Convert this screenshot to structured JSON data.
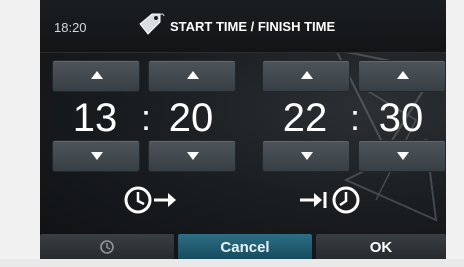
{
  "header": {
    "time": "18:20",
    "title": "START TIME / FINISH TIME",
    "title_icon": "price-tag-icon"
  },
  "start": {
    "hours": "13",
    "minutes": "20",
    "separator": ":",
    "icon": "clock-arrow-out-icon"
  },
  "finish": {
    "hours": "22",
    "minutes": "30",
    "separator": ":",
    "icon": "arrow-in-clock-icon"
  },
  "footer": {
    "clock_icon": "clock-icon",
    "cancel_label": "Cancel",
    "ok_label": "OK"
  },
  "colors": {
    "accent": "#1e5d73",
    "button": "#444b50",
    "text": "#ffffff"
  }
}
